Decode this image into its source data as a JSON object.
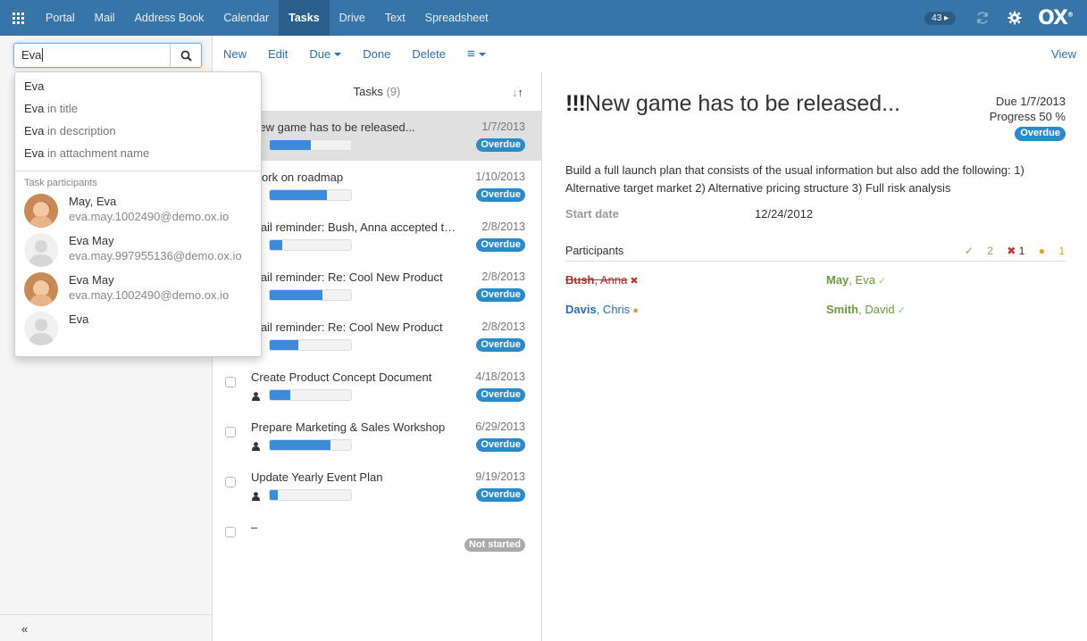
{
  "topbar": {
    "apps": [
      "Portal",
      "Mail",
      "Address Book",
      "Calendar",
      "Tasks",
      "Drive",
      "Text",
      "Spreadsheet"
    ],
    "active_app": "Tasks",
    "notification_count": "43",
    "logo": "OX"
  },
  "search": {
    "value": "Eva"
  },
  "autocomplete": {
    "options": [
      {
        "term": "Eva",
        "suffix": ""
      },
      {
        "term": "Eva",
        "suffix": " in title"
      },
      {
        "term": "Eva",
        "suffix": " in description"
      },
      {
        "term": "Eva",
        "suffix": " in attachment name"
      }
    ],
    "participants_heading": "Task participants",
    "participants": [
      {
        "name": "May, Eva",
        "email": "eva.may.1002490@demo.ox.io",
        "avatar": "photo"
      },
      {
        "name": "Eva May",
        "email": "eva.may.997955136@demo.ox.io",
        "avatar": "placeholder"
      },
      {
        "name": "Eva May",
        "email": "eva.may.1002490@demo.ox.io",
        "avatar": "photo"
      },
      {
        "name": "Eva",
        "email": "",
        "avatar": "placeholder"
      }
    ]
  },
  "sidebar": {
    "collapse_label": "«"
  },
  "toolbar": {
    "new": "New",
    "edit": "Edit",
    "due": "Due",
    "done": "Done",
    "delete": "Delete",
    "more": "≡",
    "view": "View"
  },
  "list": {
    "title": "Tasks",
    "count": "(9)",
    "sort_icon": "sort-arrows-icon",
    "tasks": [
      {
        "title": "New game has to be released...",
        "date": "1/7/2013",
        "progress": 50,
        "status": "Overdue",
        "selected": true,
        "participants": false
      },
      {
        "title": "Work on roadmap",
        "date": "1/10/2013",
        "progress": 70,
        "status": "Overdue",
        "selected": false,
        "participants": false
      },
      {
        "title": "Mail reminder: Bush, Anna accepted the invitation",
        "date": "2/8/2013",
        "progress": 15,
        "status": "Overdue",
        "selected": false,
        "participants": false
      },
      {
        "title": "Mail reminder: Re: Cool New Product",
        "date": "2/8/2013",
        "progress": 65,
        "status": "Overdue",
        "selected": false,
        "participants": false
      },
      {
        "title": "Mail reminder: Re: Cool New Product",
        "date": "2/8/2013",
        "progress": 35,
        "status": "Overdue",
        "selected": false,
        "participants": false
      },
      {
        "title": "Create Product Concept Document",
        "date": "4/18/2013",
        "progress": 25,
        "status": "Overdue",
        "selected": false,
        "participants": true
      },
      {
        "title": "Prepare Marketing & Sales Workshop",
        "date": "6/29/2013",
        "progress": 75,
        "status": "Overdue",
        "selected": false,
        "participants": true
      },
      {
        "title": "Update Yearly Event Plan",
        "date": "9/19/2013",
        "progress": 10,
        "status": "Overdue",
        "selected": false,
        "participants": true
      },
      {
        "title": "–",
        "date": "",
        "progress": null,
        "status": "Not started",
        "selected": false,
        "participants": false
      }
    ]
  },
  "detail": {
    "priority": "!!!",
    "title": "New game has to be released...",
    "due": "Due 1/7/2013",
    "progress": "Progress 50 %",
    "status": "Overdue",
    "description": "Build a full launch plan that consists of the usual information but also add the following: 1) Alternative target market 2) Alternative pricing structure 3) Full risk analysis",
    "start_label": "Start date",
    "start_value": "12/24/2012",
    "participants_label": "Participants",
    "summary": {
      "accepted": "2",
      "declined": "1",
      "tentative": "1"
    },
    "participants": [
      {
        "last": "Bush",
        "first": ", Anna",
        "state": "declined"
      },
      {
        "last": "May",
        "first": ", Eva",
        "state": "accepted"
      },
      {
        "last": "Davis",
        "first": ", Chris",
        "state": "tentative"
      },
      {
        "last": "Smith",
        "first": ", David",
        "state": "accepted"
      }
    ]
  },
  "colors": {
    "topbar": "#3774a8",
    "accent": "#2a6ebb",
    "progress": "#3d8ad8",
    "overdue": "#2d8ac9"
  }
}
